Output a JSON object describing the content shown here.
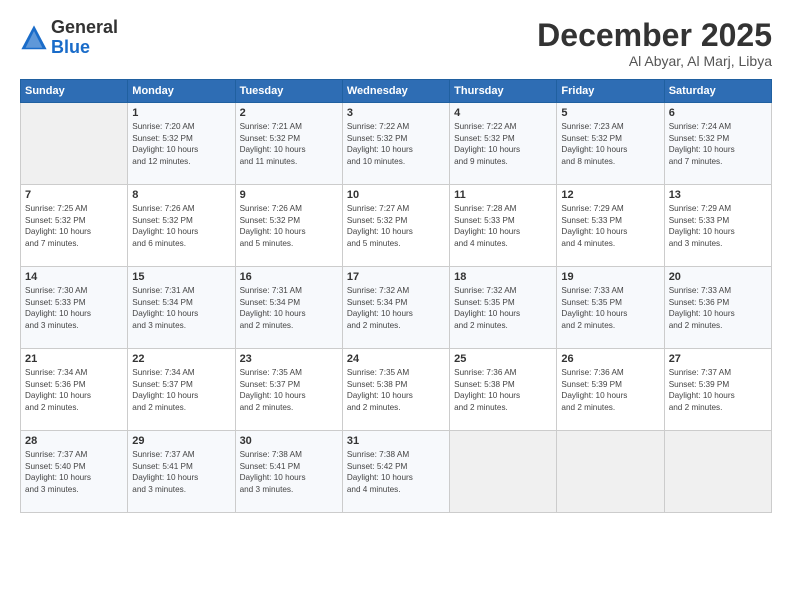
{
  "header": {
    "logo_line1": "General",
    "logo_line2": "Blue",
    "month": "December 2025",
    "location": "Al Abyar, Al Marj, Libya"
  },
  "weekdays": [
    "Sunday",
    "Monday",
    "Tuesday",
    "Wednesday",
    "Thursday",
    "Friday",
    "Saturday"
  ],
  "weeks": [
    [
      {
        "day": "",
        "info": ""
      },
      {
        "day": "1",
        "info": "Sunrise: 7:20 AM\nSunset: 5:32 PM\nDaylight: 10 hours\nand 12 minutes."
      },
      {
        "day": "2",
        "info": "Sunrise: 7:21 AM\nSunset: 5:32 PM\nDaylight: 10 hours\nand 11 minutes."
      },
      {
        "day": "3",
        "info": "Sunrise: 7:22 AM\nSunset: 5:32 PM\nDaylight: 10 hours\nand 10 minutes."
      },
      {
        "day": "4",
        "info": "Sunrise: 7:22 AM\nSunset: 5:32 PM\nDaylight: 10 hours\nand 9 minutes."
      },
      {
        "day": "5",
        "info": "Sunrise: 7:23 AM\nSunset: 5:32 PM\nDaylight: 10 hours\nand 8 minutes."
      },
      {
        "day": "6",
        "info": "Sunrise: 7:24 AM\nSunset: 5:32 PM\nDaylight: 10 hours\nand 7 minutes."
      }
    ],
    [
      {
        "day": "7",
        "info": "Sunrise: 7:25 AM\nSunset: 5:32 PM\nDaylight: 10 hours\nand 7 minutes."
      },
      {
        "day": "8",
        "info": "Sunrise: 7:26 AM\nSunset: 5:32 PM\nDaylight: 10 hours\nand 6 minutes."
      },
      {
        "day": "9",
        "info": "Sunrise: 7:26 AM\nSunset: 5:32 PM\nDaylight: 10 hours\nand 5 minutes."
      },
      {
        "day": "10",
        "info": "Sunrise: 7:27 AM\nSunset: 5:32 PM\nDaylight: 10 hours\nand 5 minutes."
      },
      {
        "day": "11",
        "info": "Sunrise: 7:28 AM\nSunset: 5:33 PM\nDaylight: 10 hours\nand 4 minutes."
      },
      {
        "day": "12",
        "info": "Sunrise: 7:29 AM\nSunset: 5:33 PM\nDaylight: 10 hours\nand 4 minutes."
      },
      {
        "day": "13",
        "info": "Sunrise: 7:29 AM\nSunset: 5:33 PM\nDaylight: 10 hours\nand 3 minutes."
      }
    ],
    [
      {
        "day": "14",
        "info": "Sunrise: 7:30 AM\nSunset: 5:33 PM\nDaylight: 10 hours\nand 3 minutes."
      },
      {
        "day": "15",
        "info": "Sunrise: 7:31 AM\nSunset: 5:34 PM\nDaylight: 10 hours\nand 3 minutes."
      },
      {
        "day": "16",
        "info": "Sunrise: 7:31 AM\nSunset: 5:34 PM\nDaylight: 10 hours\nand 2 minutes."
      },
      {
        "day": "17",
        "info": "Sunrise: 7:32 AM\nSunset: 5:34 PM\nDaylight: 10 hours\nand 2 minutes."
      },
      {
        "day": "18",
        "info": "Sunrise: 7:32 AM\nSunset: 5:35 PM\nDaylight: 10 hours\nand 2 minutes."
      },
      {
        "day": "19",
        "info": "Sunrise: 7:33 AM\nSunset: 5:35 PM\nDaylight: 10 hours\nand 2 minutes."
      },
      {
        "day": "20",
        "info": "Sunrise: 7:33 AM\nSunset: 5:36 PM\nDaylight: 10 hours\nand 2 minutes."
      }
    ],
    [
      {
        "day": "21",
        "info": "Sunrise: 7:34 AM\nSunset: 5:36 PM\nDaylight: 10 hours\nand 2 minutes."
      },
      {
        "day": "22",
        "info": "Sunrise: 7:34 AM\nSunset: 5:37 PM\nDaylight: 10 hours\nand 2 minutes."
      },
      {
        "day": "23",
        "info": "Sunrise: 7:35 AM\nSunset: 5:37 PM\nDaylight: 10 hours\nand 2 minutes."
      },
      {
        "day": "24",
        "info": "Sunrise: 7:35 AM\nSunset: 5:38 PM\nDaylight: 10 hours\nand 2 minutes."
      },
      {
        "day": "25",
        "info": "Sunrise: 7:36 AM\nSunset: 5:38 PM\nDaylight: 10 hours\nand 2 minutes."
      },
      {
        "day": "26",
        "info": "Sunrise: 7:36 AM\nSunset: 5:39 PM\nDaylight: 10 hours\nand 2 minutes."
      },
      {
        "day": "27",
        "info": "Sunrise: 7:37 AM\nSunset: 5:39 PM\nDaylight: 10 hours\nand 2 minutes."
      }
    ],
    [
      {
        "day": "28",
        "info": "Sunrise: 7:37 AM\nSunset: 5:40 PM\nDaylight: 10 hours\nand 3 minutes."
      },
      {
        "day": "29",
        "info": "Sunrise: 7:37 AM\nSunset: 5:41 PM\nDaylight: 10 hours\nand 3 minutes."
      },
      {
        "day": "30",
        "info": "Sunrise: 7:38 AM\nSunset: 5:41 PM\nDaylight: 10 hours\nand 3 minutes."
      },
      {
        "day": "31",
        "info": "Sunrise: 7:38 AM\nSunset: 5:42 PM\nDaylight: 10 hours\nand 4 minutes."
      },
      {
        "day": "",
        "info": ""
      },
      {
        "day": "",
        "info": ""
      },
      {
        "day": "",
        "info": ""
      }
    ]
  ]
}
